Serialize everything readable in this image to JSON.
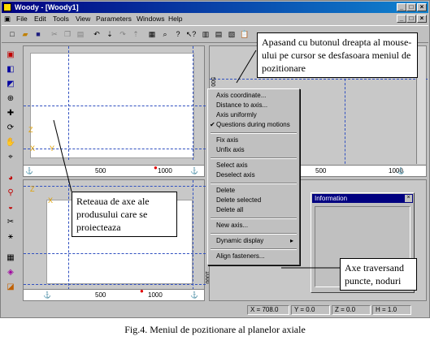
{
  "window": {
    "title": "Woody - [Woody1]"
  },
  "menu": [
    "File",
    "Edit",
    "Tools",
    "View",
    "Parameters",
    "Windows",
    "Help"
  ],
  "context_menu": {
    "items": [
      "Axis coordinate...",
      "Distance to axis...",
      "Axis uniformly",
      "Questions during motions",
      "Fix axis",
      "Unfix axis",
      "Select axis",
      "Deselect axis",
      "Delete",
      "Delete selected",
      "Delete all",
      "New axis...",
      "Dynamic display",
      "Align fasteners..."
    ],
    "checked_item": "Questions during motions"
  },
  "rulers": {
    "top_left": [
      "500",
      "1000"
    ],
    "top_right": [
      "500",
      "1000"
    ],
    "bottom_left": [
      "500",
      "1000"
    ],
    "side_top": "500",
    "side_bottom": "1000"
  },
  "axis_labels": {
    "z1": "Z",
    "y1": "Y",
    "x1": "X",
    "z2": "Z",
    "x2": "X"
  },
  "info_panel": {
    "title": "Information",
    "close": "×"
  },
  "status": {
    "x": "X = 708.0",
    "y": "Y = 0.0",
    "z": "Z = 0.0",
    "h": "H = 1.0"
  },
  "callouts": {
    "top": "Apasand cu butonul dreapta al mouse-ului pe cursor se desfasoara meniul de pozitionare",
    "left": "Reteaua de axe ale produsului care se proiecteaza",
    "right": "Axe traversand puncte, noduri"
  },
  "caption": "Fig.4. Meniul de pozitionare al planelor axiale",
  "colors": {
    "title_bar": "#000080",
    "axis_line": "#3050c0",
    "marker": "#e00000",
    "axis_label": "#e0a000"
  }
}
